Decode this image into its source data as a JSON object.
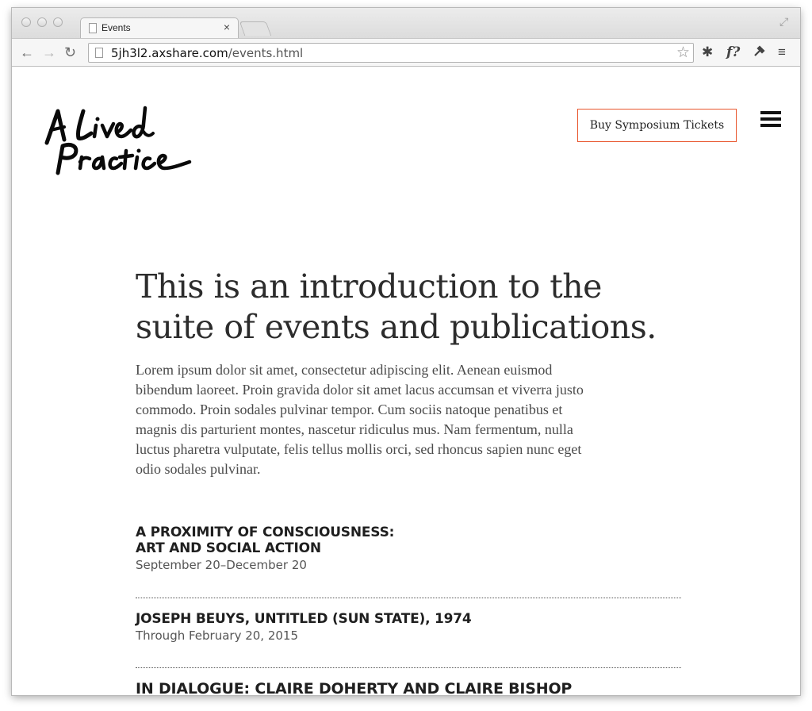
{
  "browser": {
    "tab_title": "Events",
    "tab_close": "×",
    "url_host": "5jh3l2.axshare.com",
    "url_path": "/events.html",
    "icons": [
      "back-icon",
      "forward-icon",
      "reload-icon",
      "star-icon",
      "gear-icon",
      "font-icon",
      "wrench-icon",
      "menu-icon"
    ]
  },
  "header": {
    "logo_text": "A Lived Practice",
    "cta_label": "Buy Symposium Tickets",
    "accent_color": "#e8562d"
  },
  "intro": {
    "title_line1": "This is an introduction to the",
    "title_line2": "suite of events and publications.",
    "body_lines": [
      "Lorem ipsum dolor sit amet, consectetur adipiscing elit. Aenean euismod",
      "bibendum laoreet. Proin gravida dolor sit amet lacus accumsan et viverra justo",
      "commodo. Proin sodales pulvinar tempor. Cum sociis natoque penatibus et",
      "magnis dis parturient montes, nascetur ridiculus mus. Nam fermentum, nulla",
      "luctus pharetra vulputate, felis tellus mollis orci, sed rhoncus sapien nunc eget",
      "odio sodales pulvinar."
    ]
  },
  "events": [
    {
      "title_lines": [
        "A Proximity of Consciousness:",
        "Art and Social Action"
      ],
      "date": "September 20–December 20"
    },
    {
      "title_lines": [
        "Joseph Beuys, Untitled (Sun State), 1974"
      ],
      "date": "Through February 20, 2015"
    },
    {
      "title_lines": [
        "In Dialogue: Claire Doherty and Claire Bishop"
      ],
      "date": ""
    }
  ]
}
